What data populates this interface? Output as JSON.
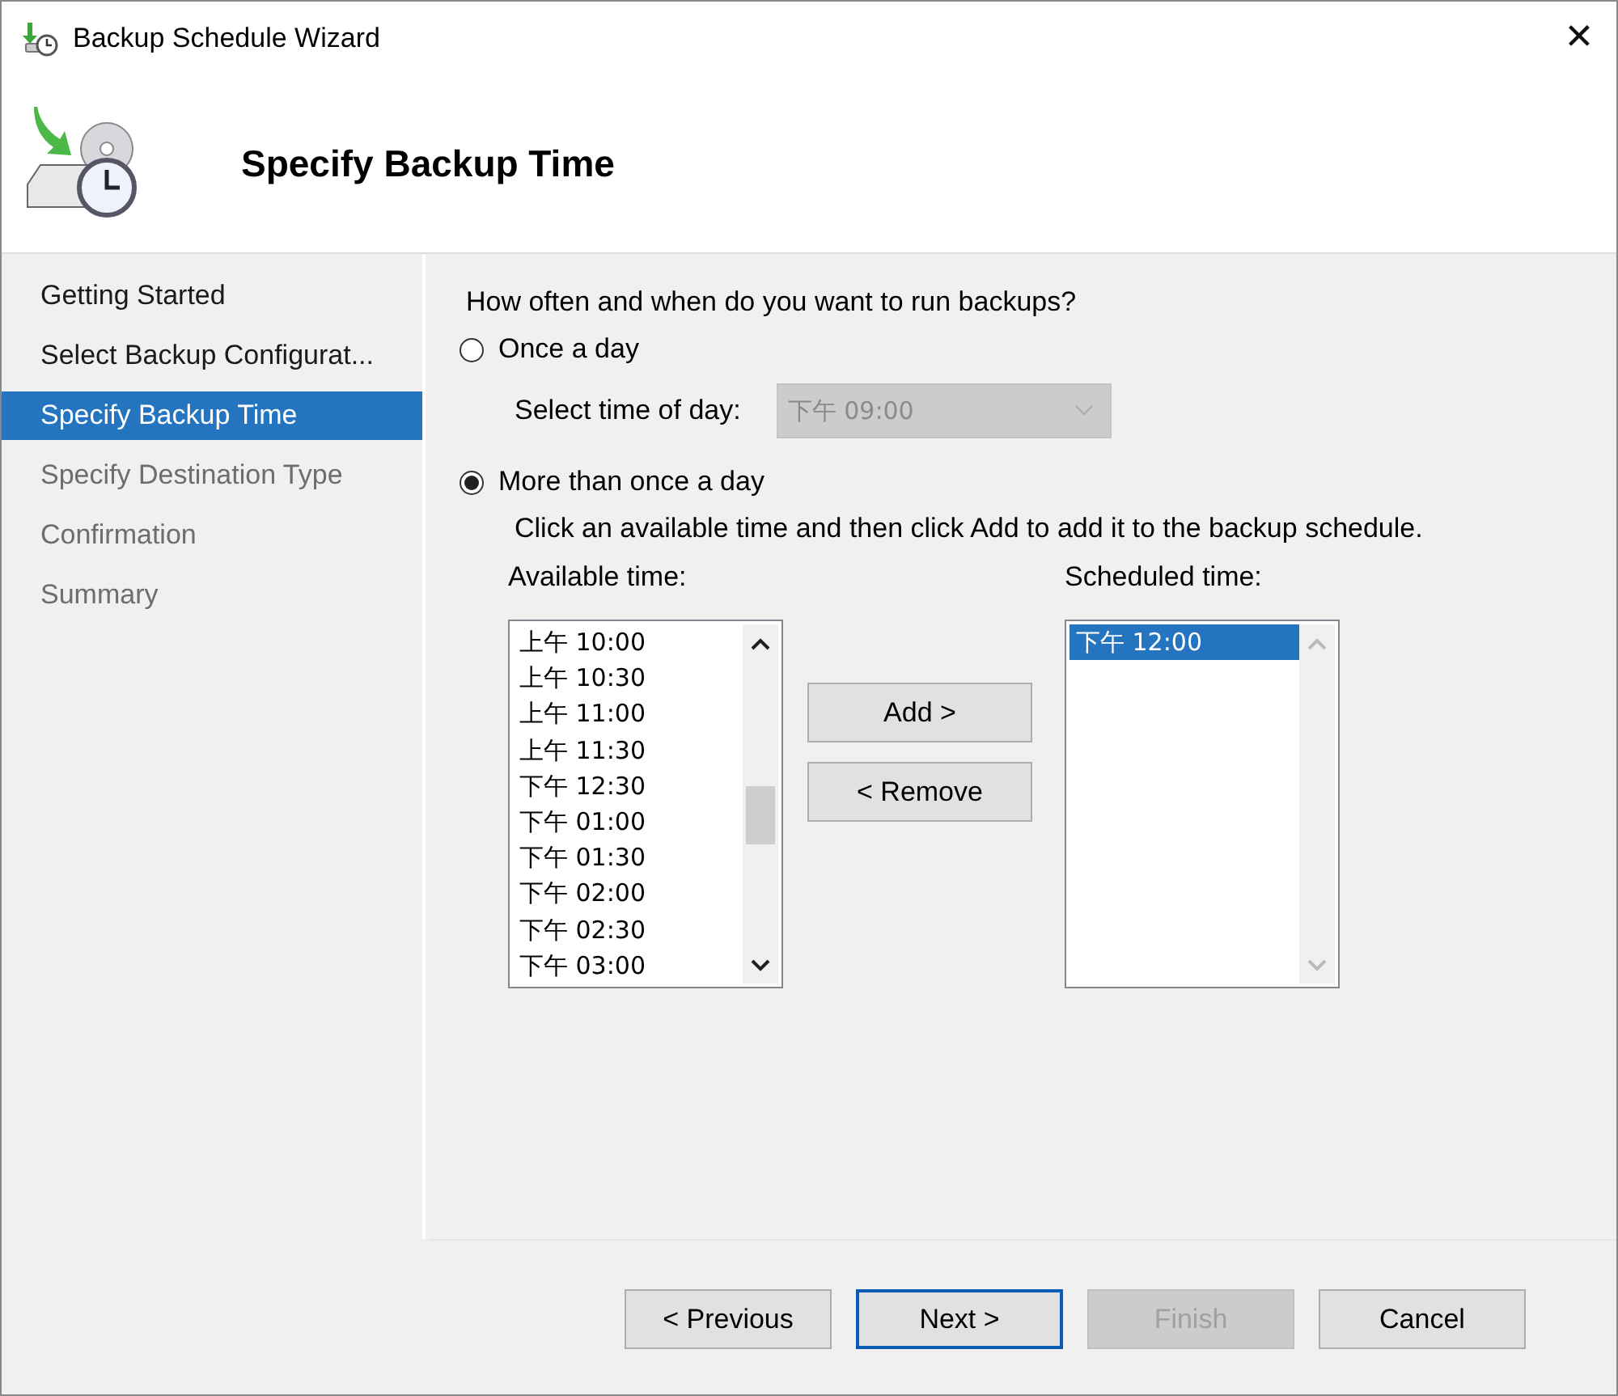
{
  "window": {
    "title": "Backup Schedule Wizard",
    "close": "✕"
  },
  "header": {
    "title": "Specify Backup Time"
  },
  "steps": [
    {
      "label": "Getting Started",
      "selected": false,
      "enabled": true
    },
    {
      "label": "Select Backup Configurat...",
      "selected": false,
      "enabled": true
    },
    {
      "label": "Specify Backup Time",
      "selected": true,
      "enabled": true
    },
    {
      "label": "Specify Destination Type",
      "selected": false,
      "enabled": false
    },
    {
      "label": "Confirmation",
      "selected": false,
      "enabled": false
    },
    {
      "label": "Summary",
      "selected": false,
      "enabled": false
    }
  ],
  "question": "How often and when do you want to run backups?",
  "options": [
    {
      "label": "Once a day",
      "selected": false
    },
    {
      "label": "More than once a day",
      "selected": true
    }
  ],
  "time_of_day": {
    "label": "Select time of day:",
    "value": "下午 09:00",
    "disabled": true
  },
  "instruction": "Click an available time and then click Add to add it to the backup schedule.",
  "available": {
    "label": "Available time:",
    "items": [
      {
        "label": "上午 10:00",
        "selected": false
      },
      {
        "label": "上午 10:30",
        "selected": false
      },
      {
        "label": "上午 11:00",
        "selected": false
      },
      {
        "label": "上午 11:30",
        "selected": false
      },
      {
        "label": "下午 12:30",
        "selected": false
      },
      {
        "label": "下午 01:00",
        "selected": false
      },
      {
        "label": "下午 01:30",
        "selected": false
      },
      {
        "label": "下午 02:00",
        "selected": false
      },
      {
        "label": "下午 02:30",
        "selected": false
      },
      {
        "label": "下午 03:00",
        "selected": false
      }
    ]
  },
  "transfer_buttons": [
    {
      "label": "Add >"
    },
    {
      "label": "< Remove"
    }
  ],
  "scheduled": {
    "label": "Scheduled time:",
    "items": [
      {
        "label": "下午 12:00",
        "selected": true
      }
    ]
  },
  "footer_buttons": [
    {
      "label": "< Previous",
      "disabled": false,
      "default": false
    },
    {
      "label": "Next >",
      "disabled": false,
      "default": true
    },
    {
      "label": "Finish",
      "disabled": true,
      "default": false
    },
    {
      "label": "Cancel",
      "disabled": false,
      "default": false
    }
  ]
}
